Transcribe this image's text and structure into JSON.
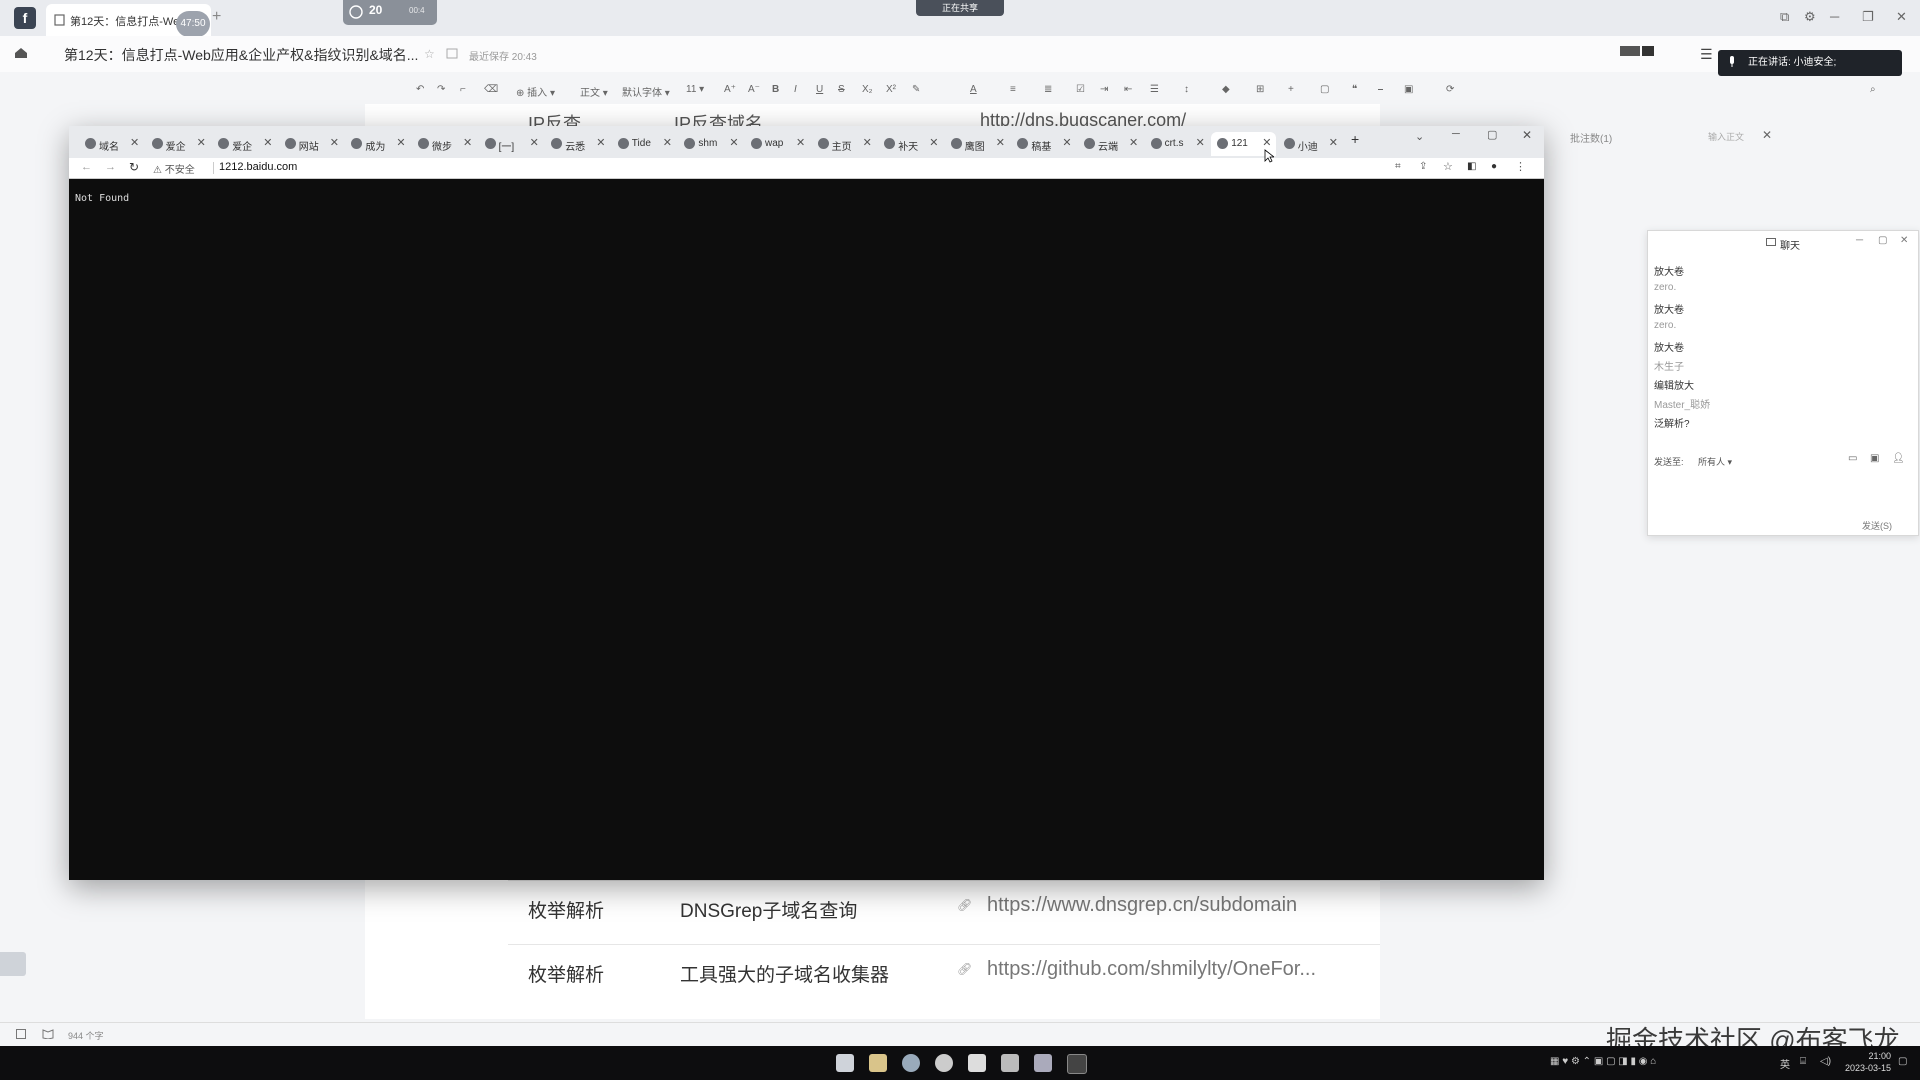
{
  "app_tab": {
    "label": "第12天：信息打点-Web...",
    "timer": "47:50",
    "meeting_count": "20",
    "meeting_sub": "00:4",
    "share": "正在共享"
  },
  "doc": {
    "title": "第12天：信息打点-Web应用&企业产权&指纹识别&域名...",
    "save_status": "最近保存 20:43",
    "speaking": "正在讲话: 小迪安全;",
    "comment_label": "批注数(1)",
    "comment_input": "输入正文"
  },
  "toolbar": {
    "insert": "插入",
    "style": "正文",
    "font": "默认字体",
    "size": "11"
  },
  "bg_table": {
    "header": [
      "IP反查",
      "IP反查域名",
      "http://dns.bugscaner.com/"
    ],
    "rows": [
      {
        "type": "枚举解析",
        "name": "DNSGrep子域名查询",
        "url": "https://www.dnsgrep.cn/subdomain"
      },
      {
        "type": "枚举解析",
        "name": "工具强大的子域名收集器",
        "url": "https://github.com/shmilylty/OneFor..."
      }
    ]
  },
  "browser": {
    "tabs": [
      {
        "label": "域名"
      },
      {
        "label": "爱企"
      },
      {
        "label": "爱企"
      },
      {
        "label": "网站"
      },
      {
        "label": "成为"
      },
      {
        "label": "微步"
      },
      {
        "label": "[一]"
      },
      {
        "label": "云悉"
      },
      {
        "label": "Tide"
      },
      {
        "label": "shm"
      },
      {
        "label": "wap"
      },
      {
        "label": "主页"
      },
      {
        "label": "补天"
      },
      {
        "label": "鹰图"
      },
      {
        "label": "稿基"
      },
      {
        "label": "云端"
      },
      {
        "label": "crt.s"
      },
      {
        "label": "121"
      },
      {
        "label": "小迪"
      }
    ],
    "active_tab": "121",
    "insecure_label": "不安全",
    "url": "1212.baidu.com",
    "page_text": "Not Found"
  },
  "chat": {
    "title": "聊天",
    "messages": [
      {
        "text": "放大卷"
      },
      {
        "text": "zero.",
        "sender": true
      },
      {
        "text": "放大卷"
      },
      {
        "text": "zero.",
        "sender": true
      },
      {
        "text": "放大卷"
      },
      {
        "text": "木生子",
        "sender": true
      },
      {
        "text": "编辑放大"
      },
      {
        "text": "Master_聪娇",
        "sender": true
      },
      {
        "text": "泛解析?"
      }
    ],
    "send_to_label": "发送至:",
    "recipient": "所有人",
    "send_button": "发送(S)"
  },
  "status_bar": {
    "word_count": "944 个字"
  },
  "watermark": "掘金技术社区 @布客飞龙",
  "taskbar": {
    "time": "21:00",
    "date": "2023-03-15",
    "ime": "英"
  }
}
